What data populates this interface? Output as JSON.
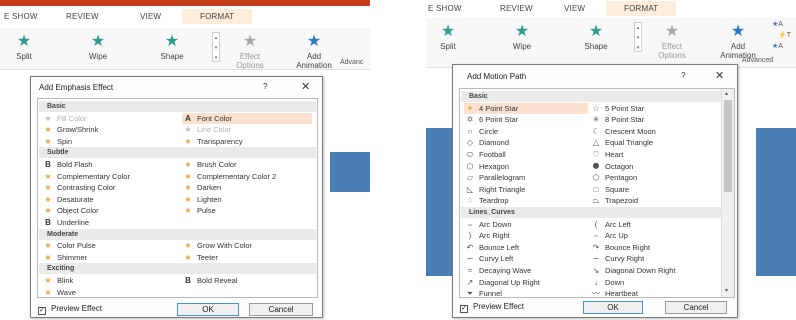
{
  "left": {
    "tabs": [
      "E SHOW",
      "REVIEW",
      "VIEW",
      "FORMAT"
    ],
    "ribbon": {
      "buttons": [
        "Split",
        "Wipe",
        "Shape"
      ],
      "effect_options": [
        "Effect",
        "Options"
      ],
      "add_animation": [
        "Add",
        "Animation"
      ],
      "group_label": "Advanc"
    },
    "dialog": {
      "title": "Add Emphasis Effect",
      "help": "?",
      "close": "✕",
      "categories": [
        "Basic",
        "Subtle",
        "Moderate",
        "Exciting"
      ],
      "items": [
        {
          "label": "Fill Color",
          "icon": "star-icon",
          "state": "disabled"
        },
        {
          "label": "Font Color",
          "icon": "font-a-icon",
          "state": "selected"
        },
        {
          "label": "Grow/Shrink",
          "icon": "star-icon",
          "state": "normal"
        },
        {
          "label": "Line Color",
          "icon": "star-icon",
          "state": "disabled"
        },
        {
          "label": "Spin",
          "icon": "star-icon",
          "state": "normal"
        },
        {
          "label": "Transparency",
          "icon": "star-icon",
          "state": "normal"
        },
        {
          "label": "Bold Flash",
          "icon": "bold-b-icon",
          "state": "normal"
        },
        {
          "label": "Brush Color",
          "icon": "star-icon",
          "state": "normal"
        },
        {
          "label": "Complementary Color",
          "icon": "star-icon",
          "state": "normal"
        },
        {
          "label": "Complementary Color 2",
          "icon": "star-icon",
          "state": "normal"
        },
        {
          "label": "Contrasting Color",
          "icon": "star-icon",
          "state": "normal"
        },
        {
          "label": "Darken",
          "icon": "star-icon",
          "state": "normal"
        },
        {
          "label": "Desaturate",
          "icon": "star-icon",
          "state": "normal"
        },
        {
          "label": "Lighten",
          "icon": "star-icon",
          "state": "normal"
        },
        {
          "label": "Object Color",
          "icon": "star-icon",
          "state": "normal"
        },
        {
          "label": "Pulse",
          "icon": "star-icon",
          "state": "normal"
        },
        {
          "label": "Underline",
          "icon": "bold-b-icon",
          "state": "normal"
        },
        {
          "label": "Color Pulse",
          "icon": "star-icon",
          "state": "normal"
        },
        {
          "label": "Grow With Color",
          "icon": "star-icon",
          "state": "normal"
        },
        {
          "label": "Shimmer",
          "icon": "star-icon",
          "state": "normal"
        },
        {
          "label": "Teeter",
          "icon": "star-icon",
          "state": "normal"
        },
        {
          "label": "Blink",
          "icon": "star-icon",
          "state": "normal"
        },
        {
          "label": "Bold Reveal",
          "icon": "bold-b-icon",
          "state": "normal"
        },
        {
          "label": "Wave",
          "icon": "star-icon",
          "state": "normal"
        }
      ],
      "preview_label": "Preview Effect",
      "ok": "OK",
      "cancel": "Cancel"
    }
  },
  "right": {
    "tabs": [
      "E SHOW",
      "REVIEW",
      "VIEW",
      "FORMAT"
    ],
    "ribbon": {
      "buttons": [
        "Split",
        "Wipe",
        "Shape"
      ],
      "effect_options": [
        "Effect",
        "Options"
      ],
      "add_animation": [
        "Add",
        "Animation"
      ],
      "group_label": "Advanced",
      "side_labels": [
        "A",
        "T",
        "A"
      ]
    },
    "dialog": {
      "title": "Add Motion Path",
      "help": "?",
      "close": "✕",
      "categories": [
        "Basic",
        "Lines_Curves"
      ],
      "items": [
        {
          "label": "4 Point Star",
          "icon": "4-point-star-icon",
          "state": "selected"
        },
        {
          "label": "5 Point Star",
          "icon": "5-point-star-icon",
          "state": "normal"
        },
        {
          "label": "6 Point Star",
          "icon": "6-point-star-icon",
          "state": "normal"
        },
        {
          "label": "8 Point Star",
          "icon": "8-point-star-icon",
          "state": "normal"
        },
        {
          "label": "Circle",
          "icon": "circle-icon",
          "state": "normal"
        },
        {
          "label": "Crescent Moon",
          "icon": "crescent-moon-icon",
          "state": "normal"
        },
        {
          "label": "Diamond",
          "icon": "diamond-icon",
          "state": "normal"
        },
        {
          "label": "Equal Triangle",
          "icon": "triangle-icon",
          "state": "normal"
        },
        {
          "label": "Football",
          "icon": "football-icon",
          "state": "normal"
        },
        {
          "label": "Heart",
          "icon": "heart-icon",
          "state": "normal"
        },
        {
          "label": "Hexagon",
          "icon": "hexagon-icon",
          "state": "normal"
        },
        {
          "label": "Octagon",
          "icon": "octagon-icon",
          "state": "normal"
        },
        {
          "label": "Parallelogram",
          "icon": "parallelogram-icon",
          "state": "normal"
        },
        {
          "label": "Pentagon",
          "icon": "pentagon-icon",
          "state": "normal"
        },
        {
          "label": "Right Triangle",
          "icon": "right-triangle-icon",
          "state": "normal"
        },
        {
          "label": "Square",
          "icon": "square-icon",
          "state": "normal"
        },
        {
          "label": "Teardrop",
          "icon": "teardrop-icon",
          "state": "normal"
        },
        {
          "label": "Trapezoid",
          "icon": "trapezoid-icon",
          "state": "normal"
        },
        {
          "label": "Arc Down",
          "icon": "arc-down-icon",
          "state": "normal"
        },
        {
          "label": "Arc Left",
          "icon": "arc-left-icon",
          "state": "normal"
        },
        {
          "label": "Arc Right",
          "icon": "arc-right-icon",
          "state": "normal"
        },
        {
          "label": "Arc Up",
          "icon": "arc-up-icon",
          "state": "normal"
        },
        {
          "label": "Bounce Left",
          "icon": "bounce-left-icon",
          "state": "normal"
        },
        {
          "label": "Bounce Right",
          "icon": "bounce-right-icon",
          "state": "normal"
        },
        {
          "label": "Curvy Left",
          "icon": "curvy-left-icon",
          "state": "normal"
        },
        {
          "label": "Curvy Right",
          "icon": "curvy-right-icon",
          "state": "normal"
        },
        {
          "label": "Decaying Wave",
          "icon": "decaying-wave-icon",
          "state": "normal"
        },
        {
          "label": "Diagonal Down Right",
          "icon": "diagonal-down-right-icon",
          "state": "normal"
        },
        {
          "label": "Diagonal Up Right",
          "icon": "diagonal-up-right-icon",
          "state": "normal"
        },
        {
          "label": "Down",
          "icon": "down-icon",
          "state": "normal"
        },
        {
          "label": "Funnel",
          "icon": "funnel-icon",
          "state": "normal"
        },
        {
          "label": "Heartbeat",
          "icon": "heartbeat-icon",
          "state": "normal"
        }
      ],
      "preview_label": "Preview Effect",
      "ok": "OK",
      "cancel": "Cancel"
    }
  },
  "colors": {
    "accent_red": "#c43e1c",
    "selection": "#fbe2cf",
    "star_orange": "#e8a33c",
    "slide_blue": "#4a7fb5"
  }
}
